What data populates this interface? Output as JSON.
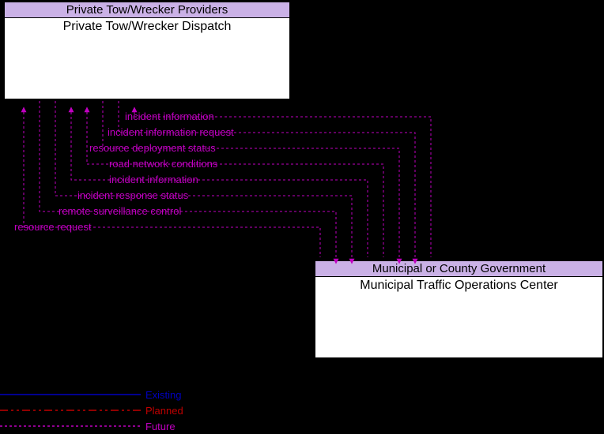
{
  "boxes": {
    "top": {
      "header": "Private Tow/Wrecker Providers",
      "body": "Private Tow/Wrecker Dispatch"
    },
    "bottom": {
      "header": "Municipal or County Government",
      "body": "Municipal Traffic Operations Center"
    }
  },
  "flows": [
    {
      "label": "incident information",
      "dir": "to_top"
    },
    {
      "label": "incident information request",
      "dir": "to_bottom"
    },
    {
      "label": "resource deployment status",
      "dir": "to_bottom"
    },
    {
      "label": "road network conditions",
      "dir": "to_top"
    },
    {
      "label": "incident information",
      "dir": "to_top"
    },
    {
      "label": "incident response status",
      "dir": "to_bottom"
    },
    {
      "label": "remote surveillance control",
      "dir": "to_bottom"
    },
    {
      "label": "resource request",
      "dir": "to_top"
    }
  ],
  "legend": {
    "existing": {
      "label": "Existing",
      "color": "#0000c0"
    },
    "planned": {
      "label": "Planned",
      "color": "#c00000"
    },
    "future": {
      "label": "Future",
      "color": "#c000c0"
    }
  },
  "style": {
    "flow_color": "#c000c0"
  }
}
